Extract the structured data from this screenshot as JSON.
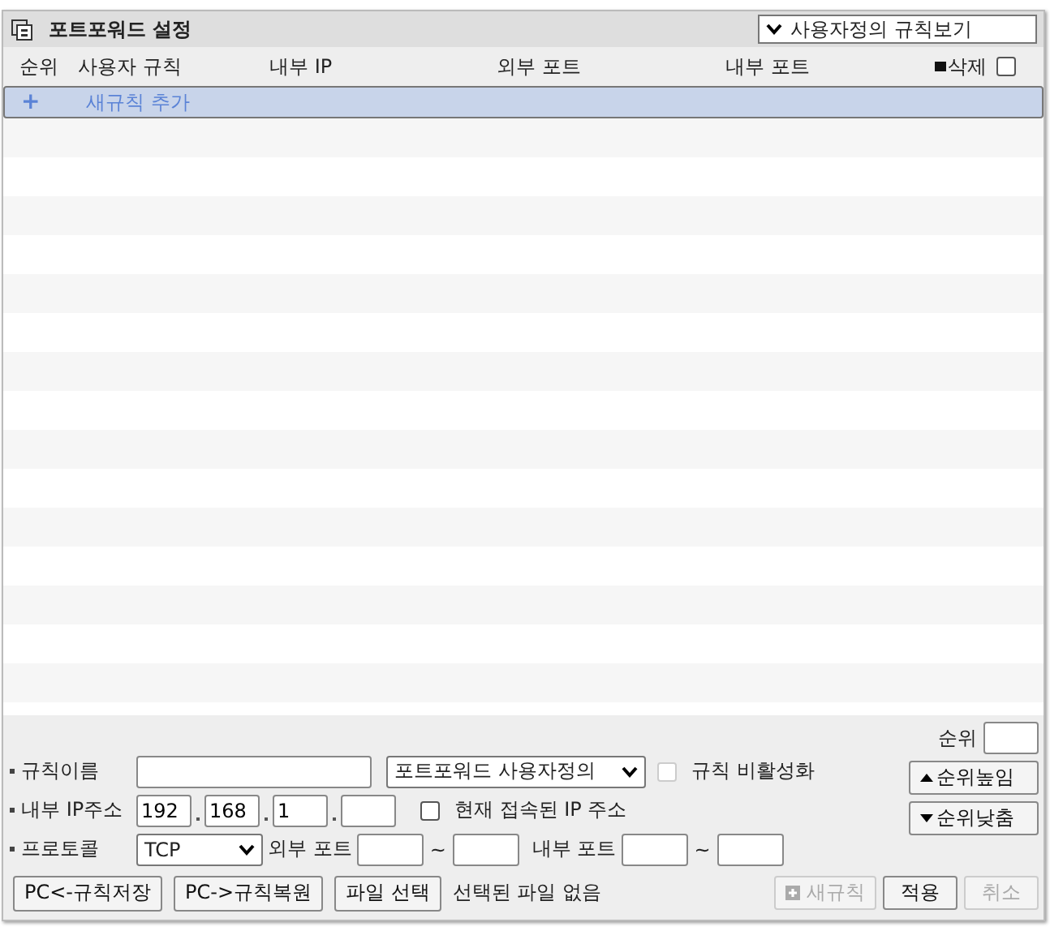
{
  "panel": {
    "title": "포트포워드 설정",
    "view_select": {
      "value": "사용자정의 규칙보기"
    }
  },
  "table": {
    "columns": [
      {
        "label": "순위"
      },
      {
        "label": "사용자 규칙"
      },
      {
        "label": "내부 IP"
      },
      {
        "label": "외부 포트"
      },
      {
        "label": "내부 포트"
      }
    ],
    "delete": {
      "label": "삭제",
      "checked": false
    },
    "add_row": {
      "icon": "+",
      "label": "새규칙 추가",
      "selected": true
    }
  },
  "form": {
    "rule_name": {
      "label": "규칙이름"
    },
    "rule_type": {
      "value": "포트포워드 사용자정의"
    },
    "disable_rule": {
      "label": "규칙 비활성화",
      "checked": false,
      "disabled": true
    },
    "ip": {
      "label": "내부 IP주소",
      "octets": [
        {
          "value": "192"
        },
        {
          "value": "168"
        },
        {
          "value": "1"
        }
      ]
    },
    "current_ip": {
      "label": "현재 접속된 IP 주소",
      "checked": false
    },
    "protocol": {
      "label": "프로토콜",
      "value": "TCP"
    },
    "ext_port": {
      "label": "외부 포트",
      "sep": "~"
    },
    "int_port": {
      "label": "내부 포트",
      "sep": "~"
    },
    "rank": {
      "label": "순위"
    },
    "rank_up": {
      "label": "순위높임"
    },
    "rank_down": {
      "label": "순위낮춤"
    }
  },
  "footer": {
    "buttons": [
      {
        "label": "PC<-규칙저장",
        "disabled": false
      },
      {
        "label": "PC->규칙복원",
        "disabled": false
      },
      {
        "label": "파일 선택",
        "disabled": false
      }
    ],
    "file_status": "선택된 파일 없음",
    "actions": [
      {
        "label": "새규칙",
        "icon": true,
        "disabled": true
      },
      {
        "label": "적용",
        "icon": false,
        "disabled": false
      },
      {
        "label": "취소",
        "icon": false,
        "disabled": true
      }
    ]
  }
}
